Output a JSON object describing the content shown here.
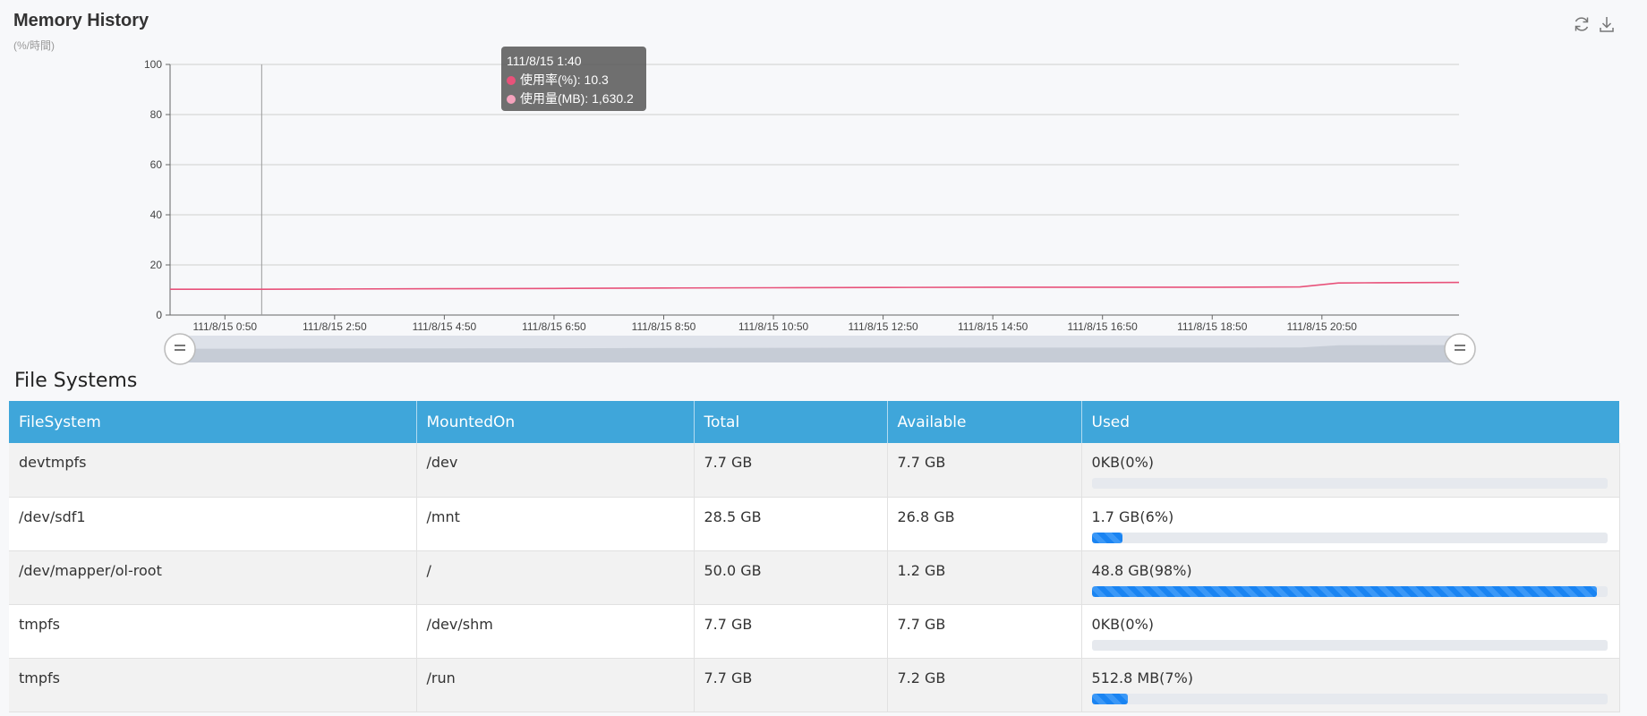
{
  "memory_history": {
    "title": "Memory History",
    "subtitle": "(%/時間)",
    "toolbar": {
      "refresh_icon": "refresh-icon",
      "download_icon": "download-icon"
    },
    "tooltip": {
      "time": "111/8/15 1:40",
      "rows": [
        {
          "label": "使用率(%): 10.3",
          "color": "#e8527a"
        },
        {
          "label": "使用量(MB): 1,630.2",
          "color": "#f5a3bd"
        }
      ]
    }
  },
  "chart_data": {
    "type": "line",
    "ylim": [
      0,
      100
    ],
    "yticks": [
      "0",
      "20",
      "40",
      "60",
      "80",
      "100"
    ],
    "xtick_labels": [
      "111/8/15 0:50",
      "111/8/15 2:50",
      "111/8/15 4:50",
      "111/8/15 6:50",
      "111/8/15 8:50",
      "111/8/15 10:50",
      "111/8/15 12:50",
      "111/8/15 14:50",
      "111/8/15 16:50",
      "111/8/15 18:50",
      "111/8/15 20:50"
    ],
    "x_start_hours": 0,
    "x_end_hours": 23.5,
    "series": [
      {
        "name": "使用率(%)",
        "color": "#e8527a",
        "points": [
          [
            0,
            10.3
          ],
          [
            1.67,
            10.3
          ],
          [
            3,
            10.4
          ],
          [
            5,
            10.5
          ],
          [
            7,
            10.6
          ],
          [
            9,
            10.8
          ],
          [
            11,
            10.9
          ],
          [
            13,
            11.0
          ],
          [
            15,
            11.1
          ],
          [
            17,
            11.1
          ],
          [
            19,
            11.1
          ],
          [
            20.6,
            11.2
          ],
          [
            21.3,
            12.8
          ],
          [
            22,
            12.9
          ],
          [
            23.5,
            13.0
          ]
        ]
      }
    ],
    "grid": true
  },
  "file_systems": {
    "title": "File Systems",
    "columns": [
      "FileSystem",
      "MountedOn",
      "Total",
      "Available",
      "Used"
    ],
    "rows": [
      {
        "filesystem": "devtmpfs",
        "mounted_on": "/dev",
        "total": "7.7 GB",
        "available": "7.7 GB",
        "used": "0KB(0%)",
        "used_pct": 0
      },
      {
        "filesystem": "/dev/sdf1",
        "mounted_on": "/mnt",
        "total": "28.5 GB",
        "available": "26.8 GB",
        "used": "1.7 GB(6%)",
        "used_pct": 6
      },
      {
        "filesystem": "/dev/mapper/ol-root",
        "mounted_on": "/",
        "total": "50.0 GB",
        "available": "1.2 GB",
        "used": "48.8 GB(98%)",
        "used_pct": 98
      },
      {
        "filesystem": "tmpfs",
        "mounted_on": "/dev/shm",
        "total": "7.7 GB",
        "available": "7.7 GB",
        "used": "0KB(0%)",
        "used_pct": 0
      },
      {
        "filesystem": "tmpfs",
        "mounted_on": "/run",
        "total": "7.7 GB",
        "available": "7.2 GB",
        "used": "512.8 MB(7%)",
        "used_pct": 7
      }
    ]
  }
}
